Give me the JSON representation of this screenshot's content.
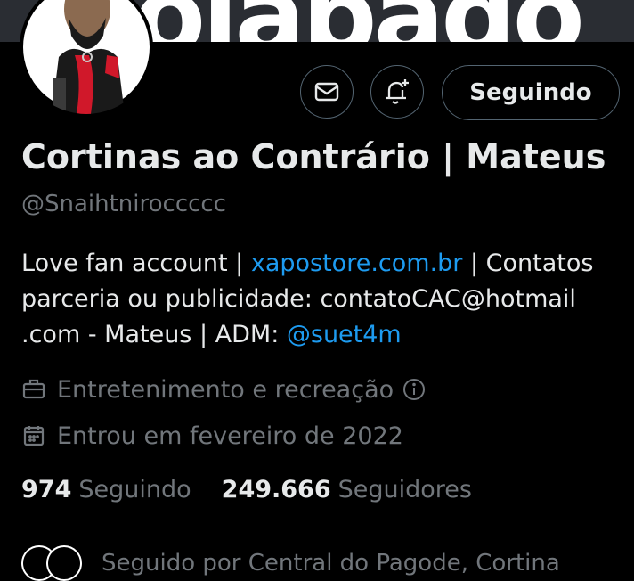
{
  "banner": {
    "text": "olabado"
  },
  "profile": {
    "display_name": "Cortinas ao Contrário | Mateus",
    "handle": "@Snaihtnirocccc c"
  },
  "actions": {
    "message_icon": "envelope-icon",
    "notify_icon": "bell-plus-icon",
    "follow_label": "Seguindo"
  },
  "bio": {
    "part1": "Love fan account | ",
    "link1": "xapostore.com.br",
    "part2": " |  Contatos parceria ou publicidade: contatoCAC@hotmail .com - Mateus | ADM: ",
    "link2": "@suet4m"
  },
  "meta": {
    "category": "Entretenimento e recreação",
    "category_icon": "briefcase-icon",
    "info_icon": "info-icon",
    "joined": "Entrou em fevereiro de 2022",
    "joined_icon": "calendar-icon"
  },
  "stats": {
    "following_count": "974",
    "following_label": "Seguindo",
    "followers_count": "249.666",
    "followers_label": "Seguidores"
  },
  "followed_by": {
    "text": "Seguido por Central do Pagode, Cortina"
  },
  "colors": {
    "accent": "#1d9bf0",
    "muted": "#71767b",
    "text": "#e7e9ea",
    "background": "#000000"
  }
}
